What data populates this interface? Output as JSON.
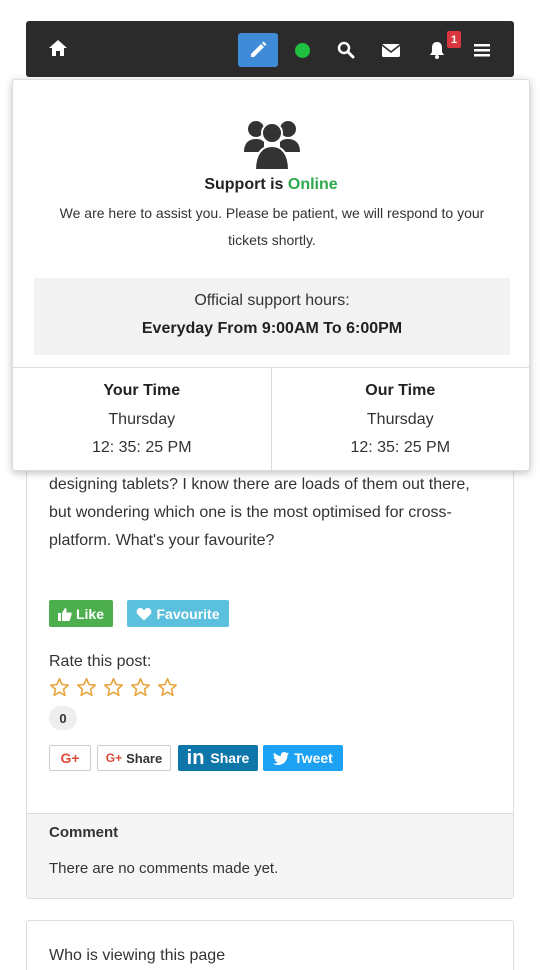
{
  "navbar": {
    "badge_count": "1",
    "icons": [
      "home-icon",
      "pencil-icon",
      "status-dot",
      "search-icon",
      "envelope-icon",
      "bell-icon",
      "menu-icon"
    ],
    "colors": {
      "bar": "#2b2b2b",
      "edit_button": "#3f8bd7",
      "status_online": "#1fbf3f",
      "badge": "#d9363e"
    }
  },
  "support_popup": {
    "status_prefix": "Support is",
    "status_value": "Online",
    "message": "We are here to assist you. Please be patient, we will respond to your tickets shortly.",
    "hours_label": "Official support hours:",
    "hours_value": "Everyday From 9:00AM To 6:00PM",
    "your_time": {
      "title": "Your Time",
      "day": "Thursday",
      "clock": "12: 35: 25 PM"
    },
    "our_time": {
      "title": "Our Time",
      "day": "Thursday",
      "clock": "12: 35: 25 PM"
    }
  },
  "post": {
    "text": "designing tablets? I know there are loads of them out there, but wondering which one is the most optimised for cross-platform. What's your favourite?",
    "like_label": "Like",
    "favourite_label": "Favourite",
    "rate_label": "Rate this post:",
    "stars_total": 5,
    "rating_count": "0",
    "share": {
      "gplus_label": "G+",
      "gshare_prefix": "G+",
      "gshare_label": "Share",
      "linkedin_label": "Share",
      "twitter_label": "Tweet"
    }
  },
  "comments": {
    "title": "Comment",
    "empty_text": "There are no comments made yet."
  },
  "viewing": {
    "title": "Who is viewing this page"
  }
}
